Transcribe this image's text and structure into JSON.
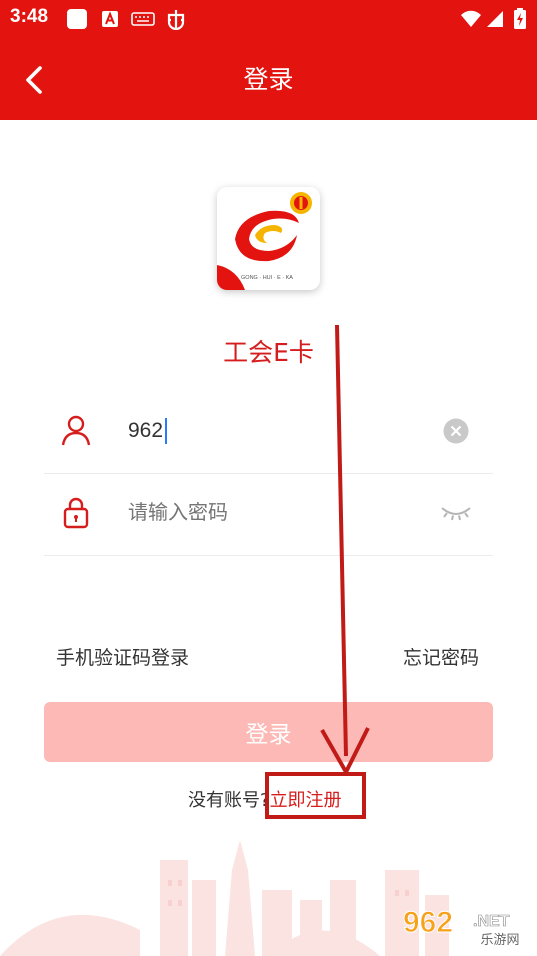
{
  "status_bar": {
    "time": "3:48"
  },
  "header": {
    "title": "登录"
  },
  "logo": {
    "caption": "GONG · HUI · E · KA"
  },
  "app_name": "工会E卡",
  "form": {
    "username_value": "962",
    "password_placeholder": "请输入密码"
  },
  "links": {
    "sms_login": "手机验证码登录",
    "forgot_password": "忘记密码"
  },
  "login_button": "登录",
  "register": {
    "prompt": "没有账号?",
    "link": "立即注册"
  },
  "watermark": {
    "brand": "962",
    "suffix": ".NET",
    "name": "乐游网"
  },
  "colors": {
    "primary": "#e3140f",
    "accent_text": "#d61d1d",
    "button_disabled": "#fdb9b6",
    "annotation": "#c11b17"
  }
}
